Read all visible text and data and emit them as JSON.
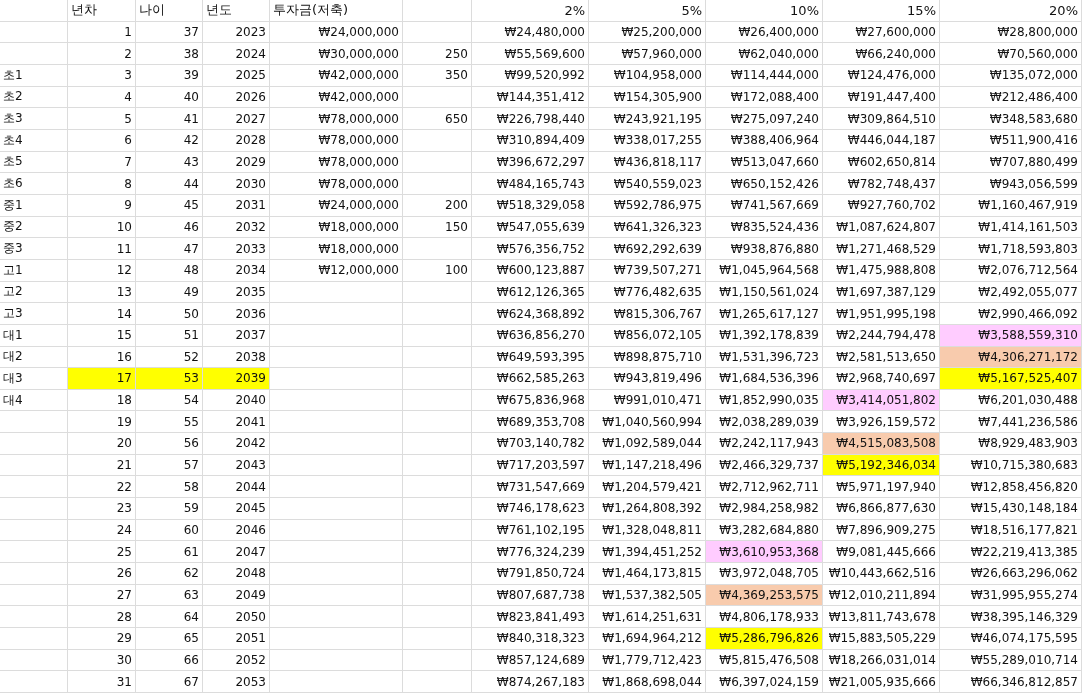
{
  "header": {
    "column_2": "년차",
    "column_3": "나이",
    "column_4": "년도",
    "column_5": "투자금(저축)",
    "rates": [
      "2%",
      "5%",
      "10%",
      "15%",
      "20%"
    ]
  },
  "rows": [
    {
      "year_no": "1",
      "age": "37",
      "year": "2023",
      "investment": "₩24,000,000",
      "rates": [
        {
          "value": "₩24,480,000"
        },
        {
          "value": "₩25,200,000"
        },
        {
          "value": "₩26,400,000"
        },
        {
          "value": "₩27,600,000"
        },
        {
          "value": "₩28,800,000"
        }
      ]
    },
    {
      "year_no": "2",
      "age": "38",
      "year": "2024",
      "investment": "₩30,000,000",
      "column_6": "250",
      "rates": [
        {
          "value": "₩55,569,600"
        },
        {
          "value": "₩57,960,000"
        },
        {
          "value": "₩62,040,000"
        },
        {
          "value": "₩66,240,000"
        },
        {
          "value": "₩70,560,000"
        }
      ]
    },
    {
      "label": "초1",
      "year_no": "3",
      "age": "39",
      "year": "2025",
      "investment": "₩42,000,000",
      "column_6": "350",
      "rates": [
        {
          "value": "₩99,520,992"
        },
        {
          "value": "₩104,958,000"
        },
        {
          "value": "₩114,444,000"
        },
        {
          "value": "₩124,476,000"
        },
        {
          "value": "₩135,072,000"
        }
      ]
    },
    {
      "label": "초2",
      "year_no": "4",
      "age": "40",
      "year": "2026",
      "investment": "₩42,000,000",
      "rates": [
        {
          "value": "₩144,351,412"
        },
        {
          "value": "₩154,305,900"
        },
        {
          "value": "₩172,088,400"
        },
        {
          "value": "₩191,447,400"
        },
        {
          "value": "₩212,486,400"
        }
      ]
    },
    {
      "label": "초3",
      "year_no": "5",
      "age": "41",
      "year": "2027",
      "investment": "₩78,000,000",
      "column_6": "650",
      "rates": [
        {
          "value": "₩226,798,440"
        },
        {
          "value": "₩243,921,195"
        },
        {
          "value": "₩275,097,240"
        },
        {
          "value": "₩309,864,510"
        },
        {
          "value": "₩348,583,680"
        }
      ]
    },
    {
      "label": "초4",
      "year_no": "6",
      "age": "42",
      "year": "2028",
      "investment": "₩78,000,000",
      "rates": [
        {
          "value": "₩310,894,409"
        },
        {
          "value": "₩338,017,255"
        },
        {
          "value": "₩388,406,964"
        },
        {
          "value": "₩446,044,187"
        },
        {
          "value": "₩511,900,416"
        }
      ]
    },
    {
      "label": "초5",
      "year_no": "7",
      "age": "43",
      "year": "2029",
      "investment": "₩78,000,000",
      "rates": [
        {
          "value": "₩396,672,297"
        },
        {
          "value": "₩436,818,117"
        },
        {
          "value": "₩513,047,660"
        },
        {
          "value": "₩602,650,814"
        },
        {
          "value": "₩707,880,499"
        }
      ]
    },
    {
      "label": "초6",
      "year_no": "8",
      "age": "44",
      "year": "2030",
      "investment": "₩78,000,000",
      "rates": [
        {
          "value": "₩484,165,743"
        },
        {
          "value": "₩540,559,023"
        },
        {
          "value": "₩650,152,426"
        },
        {
          "value": "₩782,748,437"
        },
        {
          "value": "₩943,056,599"
        }
      ]
    },
    {
      "label": "중1",
      "year_no": "9",
      "age": "45",
      "year": "2031",
      "investment": "₩24,000,000",
      "column_6": "200",
      "rates": [
        {
          "value": "₩518,329,058"
        },
        {
          "value": "₩592,786,975"
        },
        {
          "value": "₩741,567,669"
        },
        {
          "value": "₩927,760,702"
        },
        {
          "value": "₩1,160,467,919"
        }
      ]
    },
    {
      "label": "중2",
      "year_no": "10",
      "age": "46",
      "year": "2032",
      "investment": "₩18,000,000",
      "column_6": "150",
      "rates": [
        {
          "value": "₩547,055,639"
        },
        {
          "value": "₩641,326,323"
        },
        {
          "value": "₩835,524,436"
        },
        {
          "value": "₩1,087,624,807"
        },
        {
          "value": "₩1,414,161,503"
        }
      ]
    },
    {
      "label": "중3",
      "year_no": "11",
      "age": "47",
      "year": "2033",
      "investment": "₩18,000,000",
      "rates": [
        {
          "value": "₩576,356,752"
        },
        {
          "value": "₩692,292,639"
        },
        {
          "value": "₩938,876,880"
        },
        {
          "value": "₩1,271,468,529"
        },
        {
          "value": "₩1,718,593,803"
        }
      ]
    },
    {
      "label": "고1",
      "year_no": "12",
      "age": "48",
      "year": "2034",
      "investment": "₩12,000,000",
      "column_6": "100",
      "rates": [
        {
          "value": "₩600,123,887"
        },
        {
          "value": "₩739,507,271"
        },
        {
          "value": "₩1,045,964,568"
        },
        {
          "value": "₩1,475,988,808"
        },
        {
          "value": "₩2,076,712,564"
        }
      ]
    },
    {
      "label": "고2",
      "year_no": "13",
      "age": "49",
      "year": "2035",
      "rates": [
        {
          "value": "₩612,126,365"
        },
        {
          "value": "₩776,482,635"
        },
        {
          "value": "₩1,150,561,024"
        },
        {
          "value": "₩1,697,387,129"
        },
        {
          "value": "₩2,492,055,077"
        }
      ]
    },
    {
      "label": "고3",
      "year_no": "14",
      "age": "50",
      "year": "2036",
      "rates": [
        {
          "value": "₩624,368,892"
        },
        {
          "value": "₩815,306,767"
        },
        {
          "value": "₩1,265,617,127"
        },
        {
          "value": "₩1,951,995,198"
        },
        {
          "value": "₩2,990,466,092"
        }
      ]
    },
    {
      "label": "대1",
      "year_no": "15",
      "age": "51",
      "year": "2037",
      "rates": [
        {
          "value": "₩636,856,270"
        },
        {
          "value": "₩856,072,105"
        },
        {
          "value": "₩1,392,178,839"
        },
        {
          "value": "₩2,244,794,478"
        },
        {
          "value": "₩3,588,559,310",
          "color": "#ffccff"
        }
      ]
    },
    {
      "label": "대2",
      "year_no": "16",
      "age": "52",
      "year": "2038",
      "rates": [
        {
          "value": "₩649,593,395"
        },
        {
          "value": "₩898,875,710"
        },
        {
          "value": "₩1,531,396,723"
        },
        {
          "value": "₩2,581,513,650"
        },
        {
          "value": "₩4,306,271,172",
          "color": "#f8cbad"
        }
      ]
    },
    {
      "label": "대3",
      "year_no": "17",
      "age": "53",
      "year": "2039",
      "color": "#ffff00",
      "rates": [
        {
          "value": "₩662,585,263"
        },
        {
          "value": "₩943,819,496"
        },
        {
          "value": "₩1,684,536,396"
        },
        {
          "value": "₩2,968,740,697"
        },
        {
          "value": "₩5,167,525,407",
          "color": "#ffff00"
        }
      ]
    },
    {
      "label": "대4",
      "year_no": "18",
      "age": "54",
      "year": "2040",
      "rates": [
        {
          "value": "₩675,836,968"
        },
        {
          "value": "₩991,010,471"
        },
        {
          "value": "₩1,852,990,035"
        },
        {
          "value": "₩3,414,051,802",
          "color": "#ffccff"
        },
        {
          "value": "₩6,201,030,488"
        }
      ]
    },
    {
      "year_no": "19",
      "age": "55",
      "year": "2041",
      "rates": [
        {
          "value": "₩689,353,708"
        },
        {
          "value": "₩1,040,560,994"
        },
        {
          "value": "₩2,038,289,039"
        },
        {
          "value": "₩3,926,159,572"
        },
        {
          "value": "₩7,441,236,586"
        }
      ]
    },
    {
      "year_no": "20",
      "age": "56",
      "year": "2042",
      "rates": [
        {
          "value": "₩703,140,782"
        },
        {
          "value": "₩1,092,589,044"
        },
        {
          "value": "₩2,242,117,943"
        },
        {
          "value": "₩4,515,083,508",
          "color": "#f8cbad"
        },
        {
          "value": "₩8,929,483,903"
        }
      ]
    },
    {
      "year_no": "21",
      "age": "57",
      "year": "2043",
      "rates": [
        {
          "value": "₩717,203,597"
        },
        {
          "value": "₩1,147,218,496"
        },
        {
          "value": "₩2,466,329,737"
        },
        {
          "value": "₩5,192,346,034",
          "color": "#ffff00"
        },
        {
          "value": "₩10,715,380,683"
        }
      ]
    },
    {
      "year_no": "22",
      "age": "58",
      "year": "2044",
      "rates": [
        {
          "value": "₩731,547,669"
        },
        {
          "value": "₩1,204,579,421"
        },
        {
          "value": "₩2,712,962,711"
        },
        {
          "value": "₩5,971,197,940"
        },
        {
          "value": "₩12,858,456,820"
        }
      ]
    },
    {
      "year_no": "23",
      "age": "59",
      "year": "2045",
      "rates": [
        {
          "value": "₩746,178,623"
        },
        {
          "value": "₩1,264,808,392"
        },
        {
          "value": "₩2,984,258,982"
        },
        {
          "value": "₩6,866,877,630"
        },
        {
          "value": "₩15,430,148,184"
        }
      ]
    },
    {
      "year_no": "24",
      "age": "60",
      "year": "2046",
      "rates": [
        {
          "value": "₩761,102,195"
        },
        {
          "value": "₩1,328,048,811"
        },
        {
          "value": "₩3,282,684,880"
        },
        {
          "value": "₩7,896,909,275"
        },
        {
          "value": "₩18,516,177,821"
        }
      ]
    },
    {
      "year_no": "25",
      "age": "61",
      "year": "2047",
      "rates": [
        {
          "value": "₩776,324,239"
        },
        {
          "value": "₩1,394,451,252"
        },
        {
          "value": "₩3,610,953,368",
          "color": "#ffccff"
        },
        {
          "value": "₩9,081,445,666"
        },
        {
          "value": "₩22,219,413,385"
        }
      ]
    },
    {
      "year_no": "26",
      "age": "62",
      "year": "2048",
      "rates": [
        {
          "value": "₩791,850,724"
        },
        {
          "value": "₩1,464,173,815"
        },
        {
          "value": "₩3,972,048,705"
        },
        {
          "value": "₩10,443,662,516"
        },
        {
          "value": "₩26,663,296,062"
        }
      ]
    },
    {
      "year_no": "27",
      "age": "63",
      "year": "2049",
      "rates": [
        {
          "value": "₩807,687,738"
        },
        {
          "value": "₩1,537,382,505"
        },
        {
          "value": "₩4,369,253,575",
          "color": "#f8cbad"
        },
        {
          "value": "₩12,010,211,894"
        },
        {
          "value": "₩31,995,955,274"
        }
      ]
    },
    {
      "year_no": "28",
      "age": "64",
      "year": "2050",
      "rates": [
        {
          "value": "₩823,841,493"
        },
        {
          "value": "₩1,614,251,631"
        },
        {
          "value": "₩4,806,178,933"
        },
        {
          "value": "₩13,811,743,678"
        },
        {
          "value": "₩38,395,146,329"
        }
      ]
    },
    {
      "year_no": "29",
      "age": "65",
      "year": "2051",
      "rates": [
        {
          "value": "₩840,318,323"
        },
        {
          "value": "₩1,694,964,212"
        },
        {
          "value": "₩5,286,796,826",
          "color": "#ffff00"
        },
        {
          "value": "₩15,883,505,229"
        },
        {
          "value": "₩46,074,175,595"
        }
      ]
    },
    {
      "year_no": "30",
      "age": "66",
      "year": "2052",
      "rates": [
        {
          "value": "₩857,124,689"
        },
        {
          "value": "₩1,779,712,423"
        },
        {
          "value": "₩5,815,476,508"
        },
        {
          "value": "₩18,266,031,014"
        },
        {
          "value": "₩55,289,010,714"
        }
      ]
    },
    {
      "year_no": "31",
      "age": "67",
      "year": "2053",
      "rates": [
        {
          "value": "₩874,267,183"
        },
        {
          "value": "₩1,868,698,044"
        },
        {
          "value": "₩6,397,024,159"
        },
        {
          "value": "₩21,005,935,666"
        },
        {
          "value": "₩66,346,812,857"
        }
      ]
    }
  ]
}
